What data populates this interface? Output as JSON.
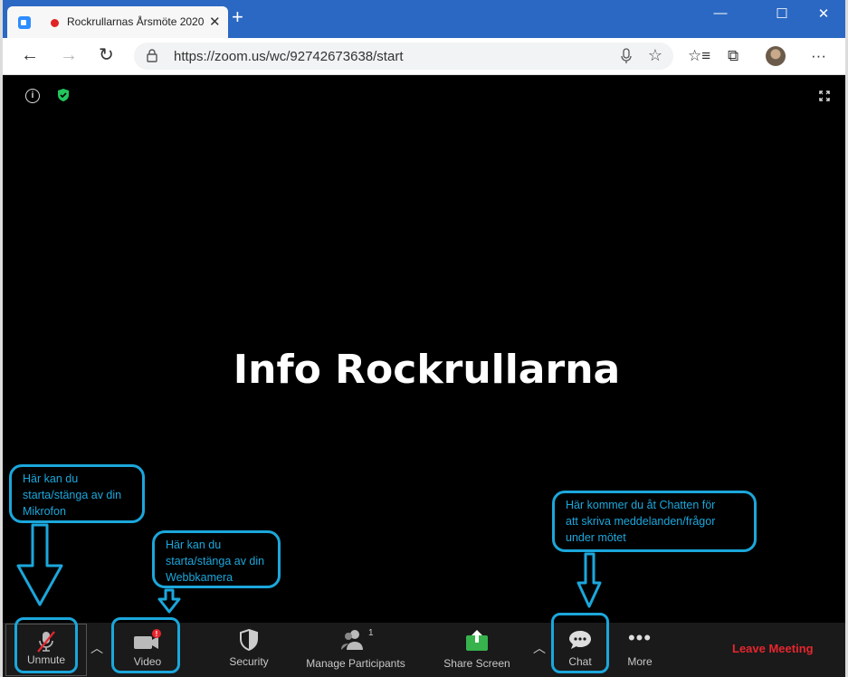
{
  "browser": {
    "tab_title": "Rockrullarnas Årsmöte 2020",
    "url": "https://zoom.us/wc/92742673638/start"
  },
  "meeting": {
    "banner_text": "Info Rockrullarna"
  },
  "annotations": {
    "mic_callout": [
      "Här kan du",
      "starta/stänga av din",
      "Mikrofon"
    ],
    "video_callout": [
      "Här kan du",
      "starta/stänga av din",
      "Webbkamera"
    ],
    "chat_callout": [
      "Här kommer du åt Chatten för",
      "att skriva meddelanden/frågor",
      "under mötet"
    ]
  },
  "toolbar": {
    "unmute_label": "Unmute",
    "video_label": "Video",
    "video_badge": "!",
    "security_label": "Security",
    "participants_label": "Manage Participants",
    "participants_count": "1",
    "share_label": "Share Screen",
    "chat_label": "Chat",
    "more_label": "More",
    "leave_label": "Leave Meeting"
  },
  "colors": {
    "annotation": "#1ba7db",
    "leave": "#e6262e",
    "share": "#37b24d",
    "titlebar": "#2b68c3"
  }
}
